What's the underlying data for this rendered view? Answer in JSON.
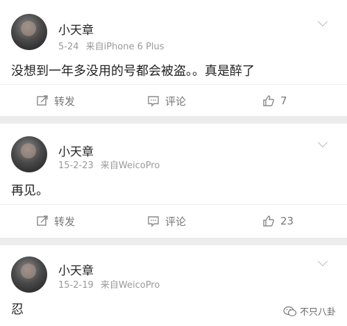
{
  "posts": [
    {
      "username": "小天章",
      "date": "5-24",
      "source": "来自iPhone 6 Plus",
      "text": "没想到一年多没用的号都会被盗。。真是醉了",
      "actions": {
        "repost": "转发",
        "comment": "评论",
        "like_count": "7"
      }
    },
    {
      "username": "小天章",
      "date": "15-2-23",
      "source": "来自WeicoPro",
      "text": "再见。",
      "actions": {
        "repost": "转发",
        "comment": "评论",
        "like_count": "23"
      }
    },
    {
      "username": "小天章",
      "date": "15-2-19",
      "source": "来自WeicoPro",
      "text": "忍"
    }
  ],
  "watermark": "不只八卦"
}
